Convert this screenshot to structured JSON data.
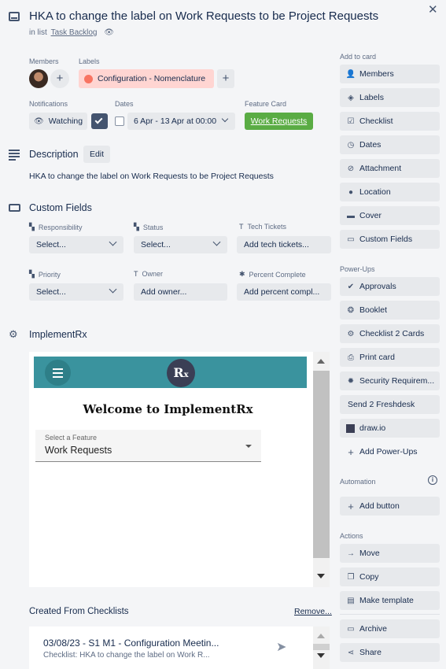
{
  "card": {
    "title": "HKA to change the label on Work Requests to be Project Requests",
    "in_list_prefix": "in list",
    "list_name": "Task Backlog"
  },
  "labels_section": {
    "members_label": "Members",
    "labels_label": "Labels",
    "label_chip": "Configuration - Nomenclature",
    "label_color": "#f87462"
  },
  "notifications": {
    "label": "Notifications",
    "watching": "Watching"
  },
  "dates": {
    "label": "Dates",
    "value": "6 Apr - 13 Apr at 00:00"
  },
  "feature_card": {
    "label": "Feature Card",
    "button": "Work Requests",
    "color": "#5aac44"
  },
  "description": {
    "title": "Description",
    "edit": "Edit",
    "text": "HKA to change the label on Work Requests to be Project Requests"
  },
  "custom_fields": {
    "title": "Custom Fields",
    "fields": [
      {
        "label": "Responsibility",
        "value": "Select..."
      },
      {
        "label": "Status",
        "value": "Select..."
      },
      {
        "label": "Tech Tickets",
        "value": "Add tech tickets..."
      },
      {
        "label": "Priority",
        "value": "Select..."
      },
      {
        "label": "Owner",
        "value": "Add owner..."
      },
      {
        "label": "Percent Complete",
        "value": "Add percent compl..."
      }
    ]
  },
  "implementrx": {
    "title": "ImplementRx",
    "welcome": "Welcome to ImplementRx",
    "select_label": "Select a Feature",
    "select_value": "Work Requests",
    "header_color": "#3a939e"
  },
  "checklists": {
    "title": "Created From Checklists",
    "remove": "Remove...",
    "item_title": "03/08/23 - S1 M1 - Configuration Meetin...",
    "item_sub": "Checklist: HKA to change the label on Work R..."
  },
  "sidebar": {
    "add_to_card": "Add to card",
    "add_items": [
      "Members",
      "Labels",
      "Checklist",
      "Dates",
      "Attachment",
      "Location",
      "Cover",
      "Custom Fields"
    ],
    "powerups_title": "Power-Ups",
    "powerups": [
      "Approvals",
      "Booklet",
      "Checklist 2 Cards",
      "Print card",
      "Security Requirem...",
      "Send 2 Freshdesk",
      "draw.io",
      "Add Power-Ups"
    ],
    "automation_title": "Automation",
    "automation_button": "Add button",
    "actions_title": "Actions",
    "actions": [
      "Move",
      "Copy",
      "Make template",
      "Archive",
      "Share"
    ]
  }
}
